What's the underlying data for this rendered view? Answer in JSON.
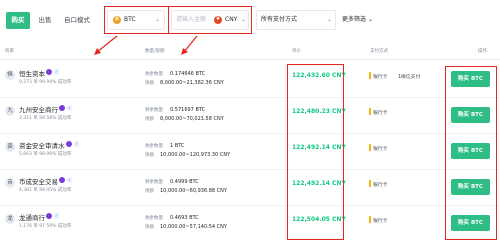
{
  "tabs": [
    "购买",
    "出售",
    "自口模式"
  ],
  "filters": {
    "coin": {
      "icon": "bitcoin-icon",
      "value": "BTC"
    },
    "amount_placeholder": "请输入金额",
    "fiat": {
      "icon": "cny-icon",
      "value": "CNY"
    },
    "payment": "所有支付方式",
    "more": "更多筛选"
  },
  "columns": [
    "商家",
    "数量/限额",
    "单价",
    "支付方式",
    "操作"
  ],
  "labels": {
    "quantity": "剩余数量",
    "limit": "限额"
  },
  "rows": [
    {
      "name": "恒生资本",
      "avatar": "恒",
      "stats": "9,273 单  99.94% 成功率",
      "quantity": "0.174646 BTC",
      "limit": "8,000.00~21,382.36 CNY",
      "price": "122,432.60 CNY",
      "payments": [
        "银行卡",
        "1微信支付"
      ],
      "button": "购买 BTC"
    },
    {
      "name": "九州安全商行",
      "avatar": "九",
      "stats": "3,311 单  99.58% 成功率",
      "quantity": "0.571697 BTC",
      "limit": "8,000.00~70,021.58 CNY",
      "price": "122,480.23 CNY",
      "payments": [
        "银行卡"
      ],
      "button": "购买 BTC"
    },
    {
      "name": "资金安全审清水",
      "avatar": "资",
      "stats": "5,663 单  98.99% 成功率",
      "quantity": "1 BTC",
      "limit": "10,000.00~120,973.30 CNY",
      "price": "122,492.14 CNY",
      "payments": [
        "银行卡"
      ],
      "button": "购买 BTC"
    },
    {
      "name": "币成安全交易",
      "avatar": "币",
      "stats": "4,381 单  99.45% 成功率",
      "quantity": "0.4999 BTC",
      "limit": "10,000.00~60,936.88 CNY",
      "price": "122,492.14 CNY",
      "payments": [
        "银行卡"
      ],
      "button": "购买 BTC"
    },
    {
      "name": "龙通商行",
      "avatar": "龙",
      "stats": "1,176 单  97.59% 成功率",
      "quantity": "0.4693 BTC",
      "limit": "10,000.00~57,140.54 CNY",
      "price": "122,504.05 CNY",
      "payments": [
        "银行卡"
      ],
      "button": "购买 BTC"
    }
  ],
  "colors": {
    "accent": "#2ebd85",
    "price": "#0ecb81",
    "annotation": "#e5281f"
  }
}
